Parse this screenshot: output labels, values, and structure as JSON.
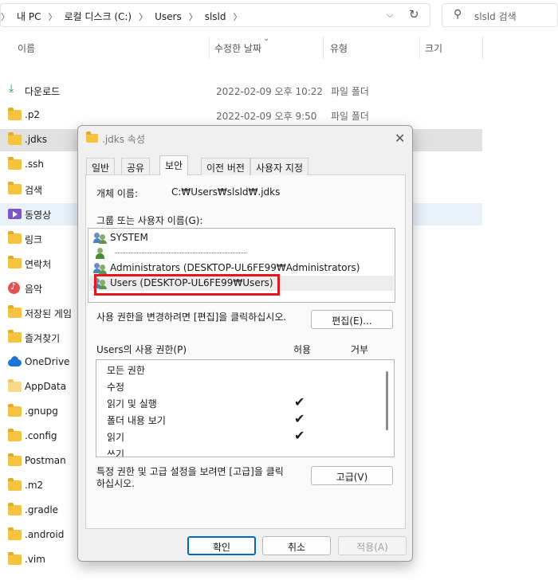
{
  "address": {
    "crumbs": [
      "내 PC",
      "로컬 디스크 (C:)",
      "Users",
      "slsld"
    ],
    "chevron_icon": "chevron-right",
    "dropdown_icon": "chevron-down",
    "refresh_icon": "refresh"
  },
  "search": {
    "placeholder": "slsld 검색",
    "icon": "search"
  },
  "columns": {
    "name": "이름",
    "modified": "수정한 날짜",
    "type": "유형",
    "size": "크기"
  },
  "files": [
    {
      "name": "다운로드",
      "date": "2022-02-09 오후 10:22",
      "type": "파일 폴더",
      "icon": "download"
    },
    {
      "name": ".p2",
      "date": "2022-02-09 오후 9:50",
      "type": "파일 폴더",
      "icon": "folder"
    },
    {
      "name": ".jdks",
      "date": "",
      "type": "",
      "icon": "folder",
      "selected": true
    },
    {
      "name": ".ssh",
      "date": "",
      "type": "",
      "icon": "folder"
    },
    {
      "name": "검색",
      "date": "",
      "type": "",
      "icon": "folder"
    },
    {
      "name": "동영상",
      "date": "",
      "type": "",
      "icon": "video",
      "hover": true
    },
    {
      "name": "링크",
      "date": "",
      "type": "",
      "icon": "folder"
    },
    {
      "name": "연락처",
      "date": "",
      "type": "",
      "icon": "folder"
    },
    {
      "name": "음악",
      "date": "",
      "type": "",
      "icon": "music"
    },
    {
      "name": "저장된 게임",
      "date": "",
      "type": "",
      "icon": "folder"
    },
    {
      "name": "즐겨찾기",
      "date": "",
      "type": "",
      "icon": "folder"
    },
    {
      "name": "OneDrive",
      "date": "",
      "type": "",
      "icon": "cloud"
    },
    {
      "name": "AppData",
      "date": "",
      "type": "",
      "icon": "folder"
    },
    {
      "name": ".gnupg",
      "date": "",
      "type": "",
      "icon": "folder"
    },
    {
      "name": ".config",
      "date": "",
      "type": "",
      "icon": "folder"
    },
    {
      "name": "Postman",
      "date": "",
      "type": "",
      "icon": "folder"
    },
    {
      "name": ".m2",
      "date": "",
      "type": "",
      "icon": "folder"
    },
    {
      "name": ".gradle",
      "date": "",
      "type": "",
      "icon": "folder"
    },
    {
      "name": ".android",
      "date": "",
      "type": "",
      "icon": "folder"
    },
    {
      "name": ".vim",
      "date": "",
      "type": "",
      "icon": "folder"
    }
  ],
  "dialog": {
    "title": ".jdks 속성",
    "close_icon": "close",
    "tabs": [
      "일반",
      "공유",
      "보안",
      "이전 버전",
      "사용자 지정"
    ],
    "active_tab": "보안",
    "object_name_label": "개체 이름:",
    "object_name_value": "C:₩Users₩slsld₩.jdks",
    "group_label": "그룹 또는 사용자 이름(G):",
    "principals": [
      {
        "name": "SYSTEM",
        "icon": "group"
      },
      {
        "name": "",
        "icon": "user",
        "redacted": true
      },
      {
        "name": "Administrators (DESKTOP-UL6FE99₩Administrators)",
        "icon": "group"
      },
      {
        "name": "Users (DESKTOP-UL6FE99₩Users)",
        "icon": "group",
        "selected": true
      }
    ],
    "edit_hint": "사용 권한을 변경하려면 [편집]을 클릭하십시오.",
    "edit_button": "편집(E)...",
    "perm_label": "Users의 사용 권한(P)",
    "allow_label": "허용",
    "deny_label": "거부",
    "permissions": [
      {
        "name": "모든 권한",
        "allow": "",
        "deny": ""
      },
      {
        "name": "수정",
        "allow": "",
        "deny": ""
      },
      {
        "name": "읽기 및 실행",
        "allow": "✔",
        "deny": ""
      },
      {
        "name": "폴더 내용 보기",
        "allow": "✔",
        "deny": ""
      },
      {
        "name": "읽기",
        "allow": "✔",
        "deny": ""
      },
      {
        "name": "쓰기",
        "allow": "",
        "deny": ""
      }
    ],
    "advanced_hint": "특정 권한 및 고급 설정을 보려면 [고급]을 클릭\n하십시오.",
    "advanced_button": "고급(V)",
    "ok_button": "확인",
    "cancel_button": "취소",
    "apply_button": "적용(A)"
  },
  "colors": {
    "highlight": "#e3171e",
    "selected_row": "#e1e1e1",
    "hover_row": "#e9f1fb",
    "accent": "#0067c0"
  }
}
